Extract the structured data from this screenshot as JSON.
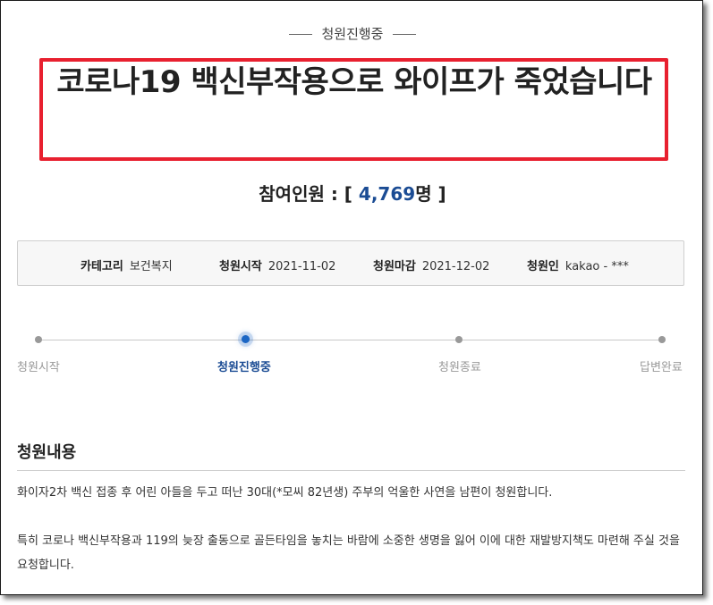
{
  "status": {
    "label": "청원진행중"
  },
  "petition": {
    "title": "코로나19 백신부작용으로 와이프가 죽었습니다",
    "participants": {
      "prefix": "참여인원 : [ ",
      "count": "4,769",
      "suffix": "명 ]"
    }
  },
  "info": [
    {
      "key": "카테고리",
      "value": "보건복지"
    },
    {
      "key": "청원시작",
      "value": "2021-11-02"
    },
    {
      "key": "청원마감",
      "value": "2021-12-02"
    },
    {
      "key": "청원인",
      "value": "kakao - ***"
    }
  ],
  "progress": {
    "active_index": 1,
    "steps": [
      {
        "label": "청원시작"
      },
      {
        "label": "청원진행중"
      },
      {
        "label": "청원종료"
      },
      {
        "label": "답변완료"
      }
    ]
  },
  "content": {
    "heading": "청원내용",
    "paragraphs": [
      "화이자2차 백신 접종 후 어린 아들을 두고 떠난 30대(*모씨 82년생) 주부의 억울한 사연을 남편이 청원합니다.",
      "특히 코로나 백신부작용과 119의 늦장 출동으로 골든타임을 놓치는 바람에 소중한 생명을 잃어 이에 대한 재발방지책도 마련해 주실 것을 요청합니다."
    ]
  },
  "colors": {
    "accent": "#1b4c94",
    "highlight_box": "#e8202f"
  }
}
